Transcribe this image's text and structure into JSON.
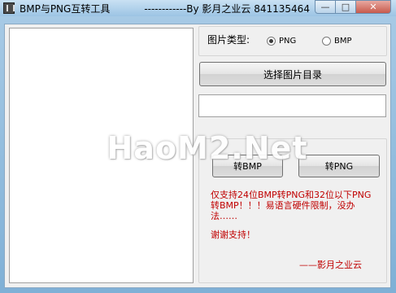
{
  "window": {
    "title": "BMP与PNG互转工具",
    "title_suffix": "------------By 影月之业云 841135464"
  },
  "options": {
    "type_label": "图片类型:",
    "radio_png": "PNG",
    "radio_bmp": "BMP",
    "selected": "PNG"
  },
  "actions": {
    "select_dir": "选择图片目录",
    "path_value": "",
    "to_bmp": "转BMP",
    "to_png": "转PNG"
  },
  "notes": {
    "info": "仅支持24位BMP转PNG和32位以下PNG转BMP！！！易语言硬件限制，没办法……",
    "thanks": "谢谢支持！",
    "signature": "——影月之业云"
  },
  "watermark": "HaoM2.Net",
  "icons": {
    "app": "app-icon",
    "minimize": "minimize-icon",
    "maximize": "maximize-icon",
    "close": "close-icon"
  }
}
